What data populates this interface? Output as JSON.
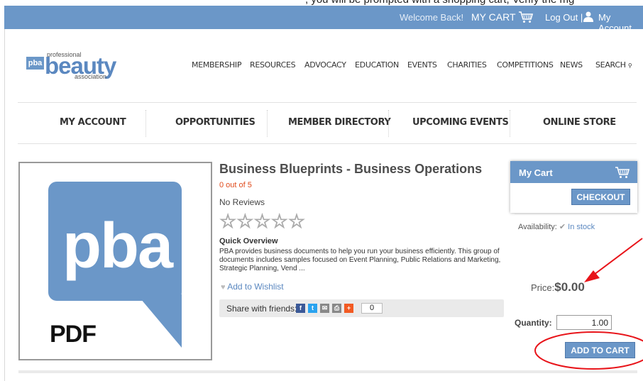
{
  "instruction_text": ", you will be prompted with a shopping cart, Verify the mg",
  "topbar": {
    "welcome": "Welcome Back!",
    "my_cart": "MY CART",
    "log_out": "Log Out |",
    "my_account": "My Account",
    "icons": [
      "cart-icon",
      "user-icon"
    ]
  },
  "logo": {
    "badge": "pba",
    "top": "professional",
    "main": "beauty",
    "bottom": "association"
  },
  "main_nav": [
    "MEMBERSHIP",
    "RESOURCES",
    "ADVOCACY",
    "EDUCATION",
    "EVENTS",
    "CHARITIES",
    "COMPETITIONS",
    "NEWS",
    "SEARCH"
  ],
  "sub_nav": [
    "MY ACCOUNT",
    "OPPORTUNITIES",
    "MEMBER DIRECTORY",
    "UPCOMING EVENTS",
    "ONLINE STORE"
  ],
  "product": {
    "image_text": "pba",
    "image_caption": "PDF",
    "title": "Business Blueprints - Business Operations",
    "rating_text": "0 out of 5",
    "rating_value": 0,
    "rating_max": 5,
    "reviews": "No Reviews",
    "stars": "☆☆☆☆☆",
    "quick_overview_label": "Quick Overview",
    "quick_overview": "PBA provides business documents to help you run your business efficiently. This group of documents includes samples focused on Event Planning, Public Relations and Marketing, Strategic Planning, Vend ...",
    "wishlist": "Add to Wishlist",
    "share_label": "Share with friends:",
    "share_icons": [
      "facebook-icon",
      "twitter-icon",
      "email-icon",
      "print-icon",
      "plus-icon"
    ],
    "share_count": "0"
  },
  "cart": {
    "title": "My Cart",
    "checkout": "CHECKOUT",
    "availability_label": "Availability:",
    "availability_value": "In stock",
    "price_label": "Price:",
    "price_value": "$0.00",
    "quantity_label": "Quantity:",
    "quantity_value": "1.00",
    "add_to_cart": "ADD TO CART"
  },
  "colors": {
    "brand_blue": "#6b97c8",
    "rating_red": "#e04a1b",
    "annotation_red": "#e8141a"
  }
}
